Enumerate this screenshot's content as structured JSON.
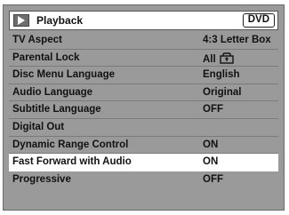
{
  "header": {
    "title": "Playback",
    "badge": "DVD",
    "icon": "play-icon"
  },
  "rows": [
    {
      "label": "TV Aspect",
      "value": "4:3 Letter Box"
    },
    {
      "label": "Parental Lock",
      "value": "All",
      "icon": "lock-icon"
    },
    {
      "label": "Disc Menu Language",
      "value": "English"
    },
    {
      "label": "Audio Language",
      "value": "Original"
    },
    {
      "label": "Subtitle Language",
      "value": "OFF"
    },
    {
      "label": "Digital Out",
      "value": ""
    },
    {
      "label": "Dynamic Range Control",
      "value": "ON"
    },
    {
      "label": "Fast Forward with Audio",
      "value": "ON",
      "selected": true
    },
    {
      "label": "Progressive",
      "value": "OFF"
    }
  ]
}
